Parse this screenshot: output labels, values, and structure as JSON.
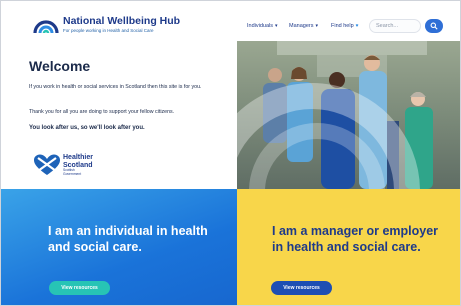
{
  "header": {
    "title": "National Wellbeing Hub",
    "subtitle": "For people working in Health and Social Care",
    "nav": [
      {
        "label": "Individuals",
        "has_dropdown": true
      },
      {
        "label": "Managers",
        "has_dropdown": true
      },
      {
        "label": "Find help",
        "has_dropdown": false
      }
    ],
    "search_placeholder": "Search..."
  },
  "hero": {
    "heading": "Welcome",
    "paragraph1": "If you work in health or social services in Scotland then this site is for you.",
    "paragraph2": "Thank you for all you are doing to support your fellow citizens.",
    "tagline": "You look after us, so we'll look after you.",
    "partner_name": "Healthier Scotland",
    "partner_gov": "Scottish Government"
  },
  "cards": {
    "individual": {
      "title": "I am an individual in health and social care.",
      "button": "View resources"
    },
    "manager": {
      "title": "I am a manager or employer in health and social care.",
      "button": "View resources"
    }
  },
  "colors": {
    "brand_navy": "#1e3a8a",
    "individual_blue": "#1a73d9",
    "manager_yellow": "#f8d64a",
    "teal_button": "#27c4b5"
  }
}
